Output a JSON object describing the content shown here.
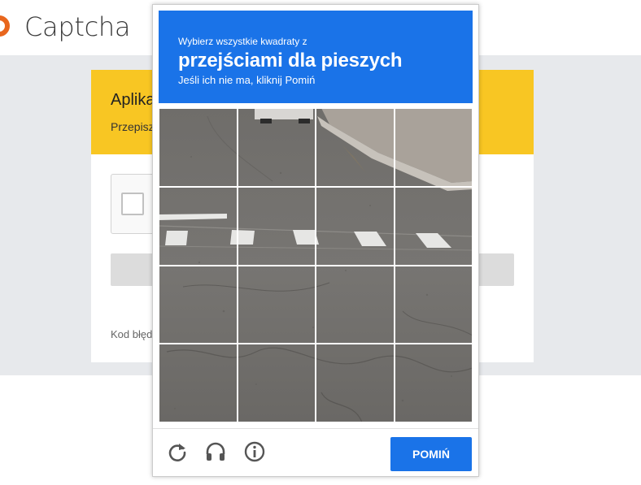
{
  "app": {
    "title": "Captcha"
  },
  "card": {
    "title": "Aplika",
    "subtitle": "Przepisz",
    "error_code": "Kod błęd"
  },
  "captcha": {
    "instruction_small": "Wybierz wszystkie kwadraty z",
    "instruction_big": "przejściami dla pieszych",
    "instruction_hint": "Jeśli ich nie ma, kliknij Pomiń",
    "grid_rows": 4,
    "grid_cols": 4,
    "skip_label": "POMIŃ",
    "icons": [
      "reload-icon",
      "audio-icon",
      "info-icon"
    ]
  },
  "colors": {
    "accent": "#1a73e8",
    "header_yellow": "#f8c623",
    "logo_orange": "#e8661d"
  }
}
